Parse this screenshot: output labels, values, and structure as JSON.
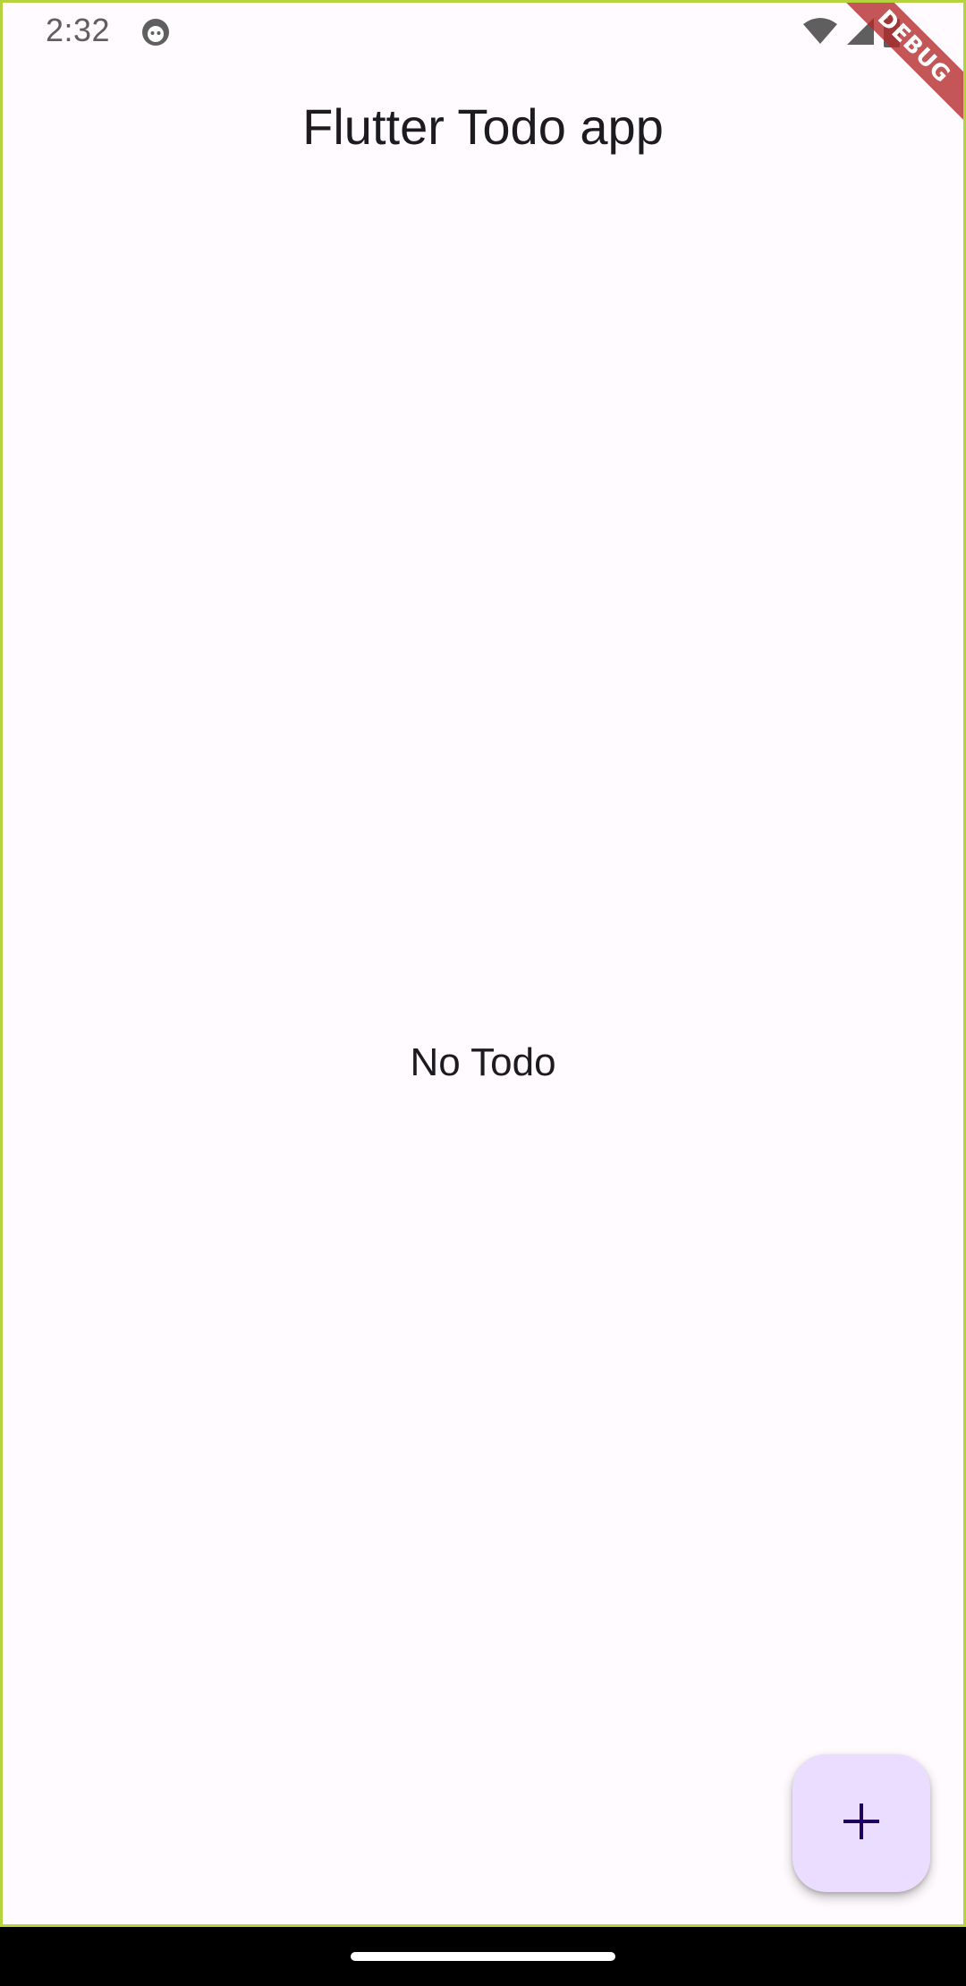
{
  "status_bar": {
    "time": "2:32",
    "icons": [
      "face-icon",
      "wifi-icon",
      "cellular-signal-icon",
      "battery-icon"
    ]
  },
  "debug_banner": {
    "label": "DEBUG"
  },
  "app_bar": {
    "title": "Flutter Todo app"
  },
  "content": {
    "empty_message": "No Todo"
  },
  "fab": {
    "icon": "add-icon"
  },
  "colors": {
    "background": "#fffbfe",
    "fab_background": "#eaddff",
    "fab_icon": "#21005d",
    "text": "#1c1b1f",
    "debug_ribbon": "#b42828",
    "frame_border": "#b5d33c"
  }
}
